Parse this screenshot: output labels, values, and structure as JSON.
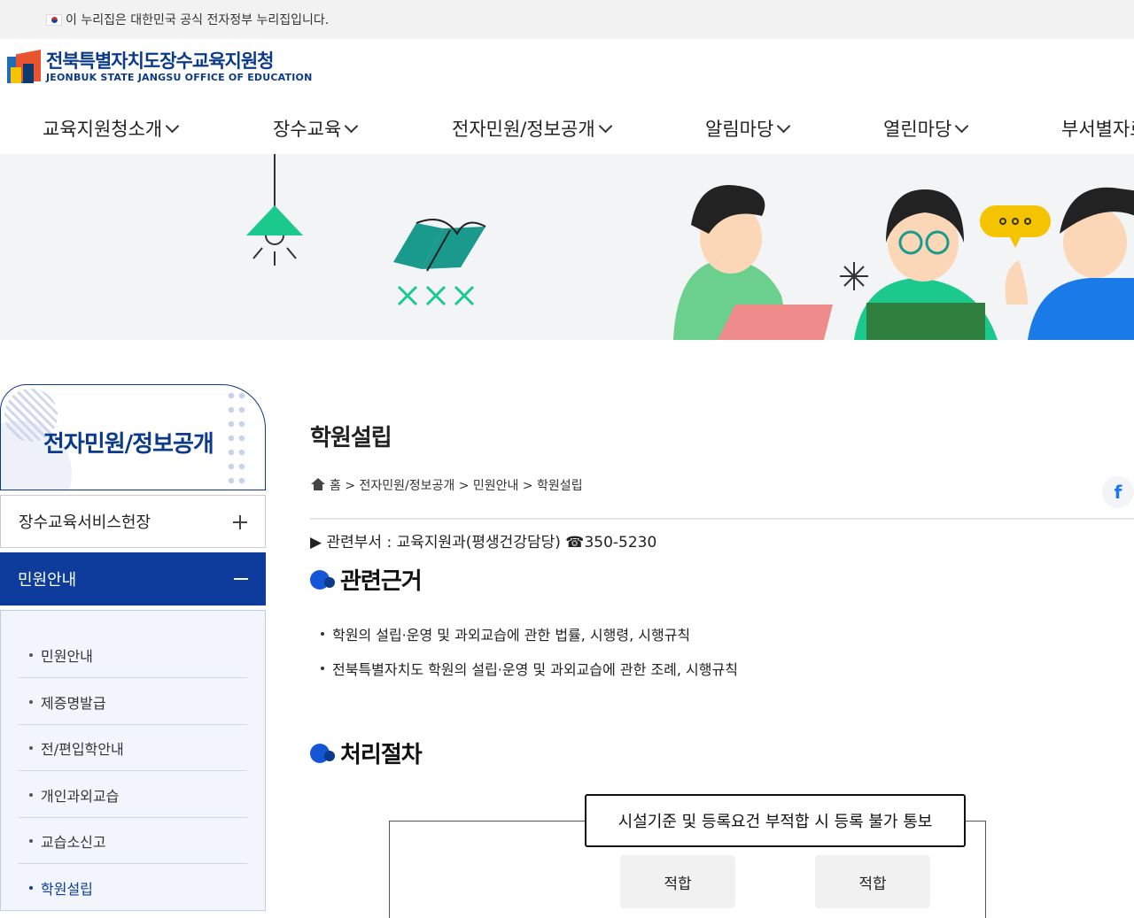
{
  "gov_banner": {
    "text": "이 누리집은 대한민국 공식 전자정부 누리집입니다."
  },
  "logo": {
    "name_ko": "전북특별자치도장수교육지원청",
    "name_en": "JEONBUK STATE JANGSU OFFICE OF EDUCATION"
  },
  "gnb": [
    {
      "label": "교육지원청소개"
    },
    {
      "label": "장수교육"
    },
    {
      "label": "전자민원/정보공개"
    },
    {
      "label": "알림마당"
    },
    {
      "label": "열린마당"
    },
    {
      "label": "부서별자료"
    }
  ],
  "sidebar": {
    "title": "전자민원/정보공개",
    "menu1": "장수교육서비스헌장",
    "menu2": "민원안내",
    "sub": [
      {
        "label": "민원안내"
      },
      {
        "label": "제증명발급"
      },
      {
        "label": "전/편입학안내"
      },
      {
        "label": "개인과외교습"
      },
      {
        "label": "교습소신고"
      },
      {
        "label": "학원설립"
      }
    ]
  },
  "content": {
    "title": "학원설립",
    "breadcrumb": "홈 > 전자민원/정보공개 > 민원안내 > 학원설립",
    "dept": "▶ 관련부서 : 교육지원과(평생건강담당) ☎350-5230",
    "section1": "관련근거",
    "laws": [
      "학원의 설립·운영 및 과외교습에 관한 법률, 시행령, 시행규칙",
      "전북특별자치도 학원의 설립·운영 및 과외교습에 관한 조례, 시행규칙"
    ],
    "section2": "처리절차",
    "flow": {
      "notice": "시설기준 및 등록요건 부적합 시 등록 불가 통보",
      "btn1": "적합",
      "btn2": "적합"
    }
  },
  "colors": {
    "primary": "#0d3c9c",
    "accent": "#1456d6"
  },
  "icons": {
    "home": "home-icon",
    "facebook": "facebook-icon",
    "flag": "taegukgi-flag-icon"
  }
}
